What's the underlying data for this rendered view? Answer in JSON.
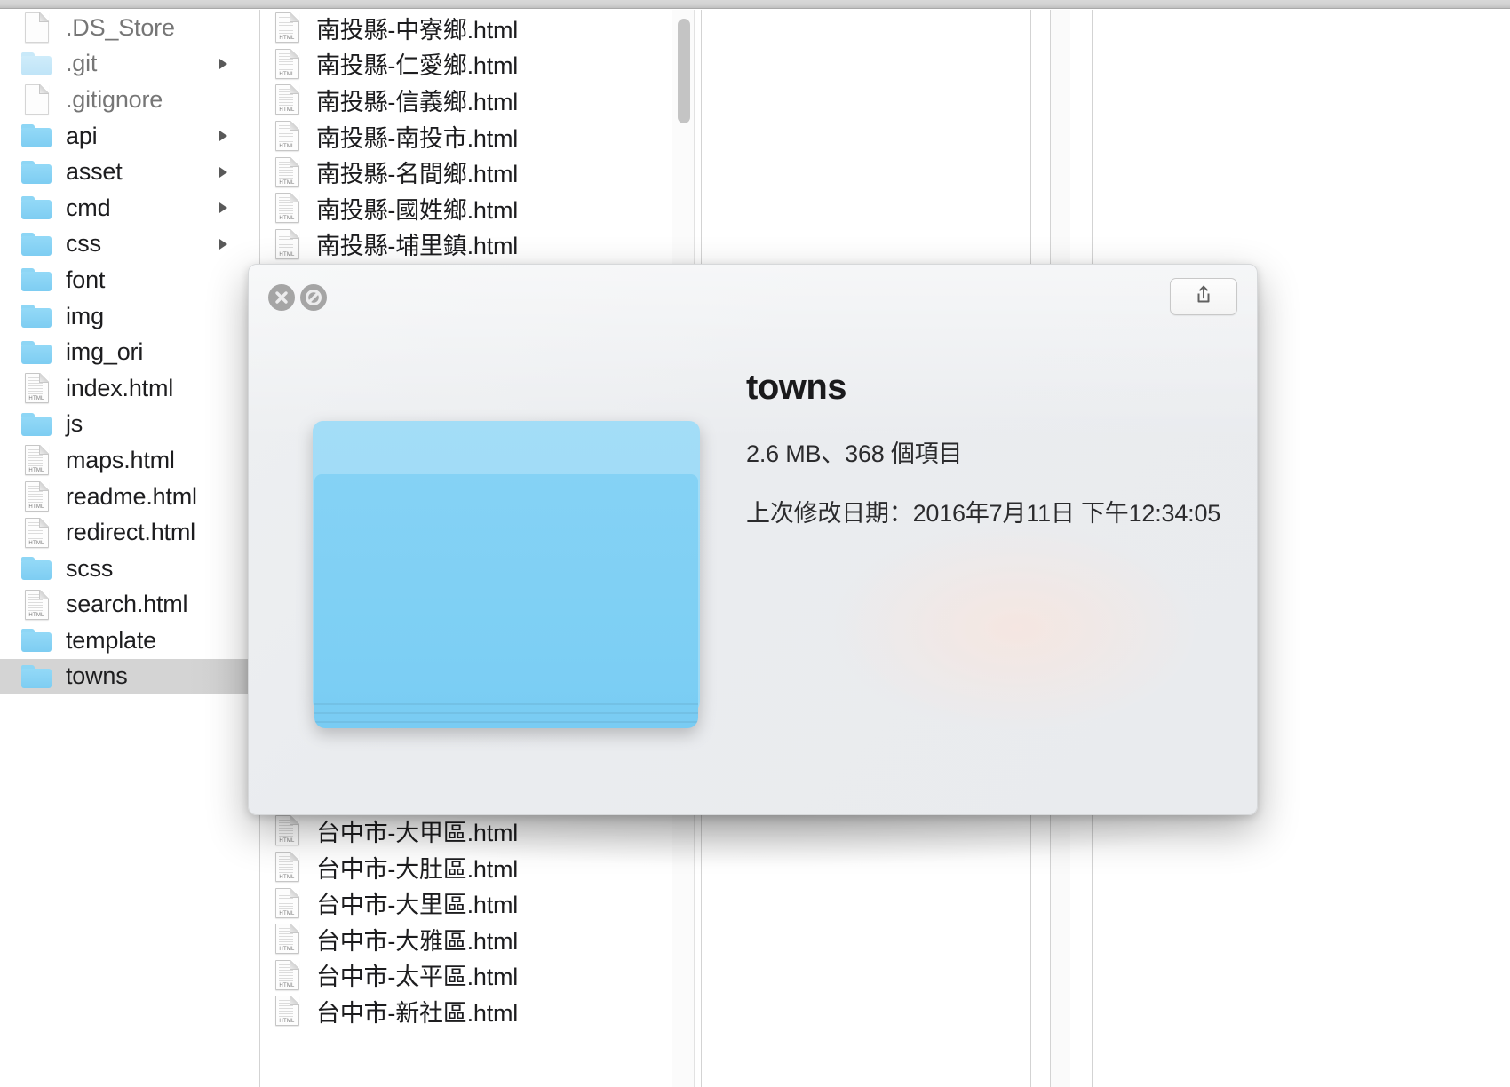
{
  "window": {
    "view_mode": "column-view"
  },
  "sidebar": {
    "items": [
      {
        "label": ".DS_Store",
        "icon": "document-icon",
        "kind": "file",
        "dim": true,
        "expandable": false,
        "selected": false
      },
      {
        "label": ".git",
        "icon": "folder-icon",
        "kind": "folder",
        "dim": true,
        "expandable": true,
        "selected": false
      },
      {
        "label": ".gitignore",
        "icon": "document-icon",
        "kind": "file",
        "dim": true,
        "expandable": false,
        "selected": false
      },
      {
        "label": "api",
        "icon": "folder-icon",
        "kind": "folder",
        "dim": false,
        "expandable": true,
        "selected": false
      },
      {
        "label": "asset",
        "icon": "folder-icon",
        "kind": "folder",
        "dim": false,
        "expandable": true,
        "selected": false
      },
      {
        "label": "cmd",
        "icon": "folder-icon",
        "kind": "folder",
        "dim": false,
        "expandable": true,
        "selected": false
      },
      {
        "label": "css",
        "icon": "folder-icon",
        "kind": "folder",
        "dim": false,
        "expandable": true,
        "selected": false
      },
      {
        "label": "font",
        "icon": "folder-icon",
        "kind": "folder",
        "dim": false,
        "expandable": false,
        "selected": false
      },
      {
        "label": "img",
        "icon": "folder-icon",
        "kind": "folder",
        "dim": false,
        "expandable": false,
        "selected": false
      },
      {
        "label": "img_ori",
        "icon": "folder-icon",
        "kind": "folder",
        "dim": false,
        "expandable": false,
        "selected": false
      },
      {
        "label": "index.html",
        "icon": "html-file-icon",
        "kind": "file",
        "dim": false,
        "expandable": false,
        "selected": false
      },
      {
        "label": "js",
        "icon": "folder-icon",
        "kind": "folder",
        "dim": false,
        "expandable": false,
        "selected": false
      },
      {
        "label": "maps.html",
        "icon": "html-file-icon",
        "kind": "file",
        "dim": false,
        "expandable": false,
        "selected": false
      },
      {
        "label": "readme.html",
        "icon": "html-file-icon",
        "kind": "file",
        "dim": false,
        "expandable": false,
        "selected": false
      },
      {
        "label": "redirect.html",
        "icon": "html-file-icon",
        "kind": "file",
        "dim": false,
        "expandable": false,
        "selected": false
      },
      {
        "label": "scss",
        "icon": "folder-icon",
        "kind": "folder",
        "dim": false,
        "expandable": false,
        "selected": false
      },
      {
        "label": "search.html",
        "icon": "html-file-icon",
        "kind": "file",
        "dim": false,
        "expandable": false,
        "selected": false
      },
      {
        "label": "template",
        "icon": "folder-icon",
        "kind": "folder",
        "dim": false,
        "expandable": false,
        "selected": false
      },
      {
        "label": "towns",
        "icon": "folder-icon",
        "kind": "folder",
        "dim": false,
        "expandable": false,
        "selected": true
      }
    ]
  },
  "file_list": {
    "items": [
      {
        "label": "南投縣-中寮鄉.html",
        "icon": "html-file-icon"
      },
      {
        "label": "南投縣-仁愛鄉.html",
        "icon": "html-file-icon"
      },
      {
        "label": "南投縣-信義鄉.html",
        "icon": "html-file-icon"
      },
      {
        "label": "南投縣-南投市.html",
        "icon": "html-file-icon"
      },
      {
        "label": "南投縣-名間鄉.html",
        "icon": "html-file-icon"
      },
      {
        "label": "南投縣-國姓鄉.html",
        "icon": "html-file-icon"
      },
      {
        "label": "南投縣-埔里鎮.html",
        "icon": "html-file-icon"
      }
    ],
    "items_bottom": [
      {
        "label": "台中市-大甲區.html",
        "icon": "html-file-icon"
      },
      {
        "label": "台中市-大肚區.html",
        "icon": "html-file-icon"
      },
      {
        "label": "台中市-大里區.html",
        "icon": "html-file-icon"
      },
      {
        "label": "台中市-大雅區.html",
        "icon": "html-file-icon"
      },
      {
        "label": "台中市-太平區.html",
        "icon": "html-file-icon"
      },
      {
        "label": "台中市-新社區.html",
        "icon": "html-file-icon"
      }
    ]
  },
  "quicklook": {
    "title": "towns",
    "size_and_count": "2.6 MB、368 個項目",
    "modified": "上次修改日期：2016年7月11日 下午12:34:05",
    "icon": "folder-icon-large",
    "buttons": {
      "close": "close-icon",
      "block": "no-entry-icon",
      "share": "share-icon"
    }
  },
  "colors": {
    "folder_blue": "#7ecdf2",
    "folder_blue_light": "#a3ddf7",
    "selection_gray": "#d4d4d4",
    "text_primary": "#1d1d1f",
    "text_dim": "#767676",
    "panel_bg": "#eaecef"
  }
}
